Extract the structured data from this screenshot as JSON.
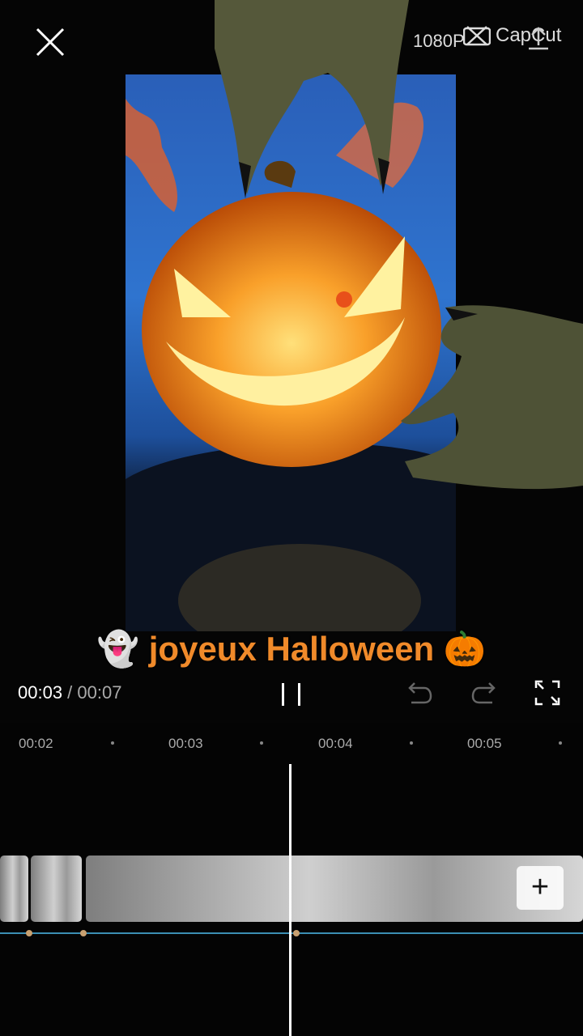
{
  "topbar": {
    "resolution": "1080P",
    "watermark": "CapCut"
  },
  "caption": {
    "left_emoji": "👻",
    "text": " joyeux Halloween ",
    "right_emoji": "🎃"
  },
  "player": {
    "current_time": "00:03",
    "separator": " / ",
    "total_time": "00:07"
  },
  "timeline": {
    "ticks": [
      "00:02",
      "00:03",
      "00:04",
      "00:05"
    ]
  },
  "colors": {
    "caption": "#f08a2a",
    "audio_line": "#3b8fb3"
  }
}
